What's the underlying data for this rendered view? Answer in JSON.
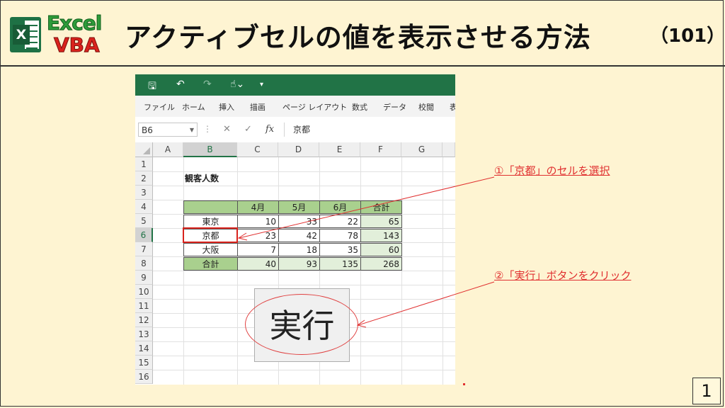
{
  "header": {
    "logo_top": "Excel",
    "logo_bottom": "VBA",
    "logo_tile_letter": "X",
    "title": "アクティブセルの値を表示させる方法",
    "number": "（101）"
  },
  "excel": {
    "qat_icons": [
      "save-icon",
      "undo-icon",
      "redo-icon",
      "touch-mode-icon",
      "customize-icon"
    ],
    "ribbon_tabs": [
      "ファイル",
      "ホーム",
      "挿入",
      "描画",
      "ページ レイアウト",
      "数式",
      "データ",
      "校閲",
      "表"
    ],
    "name_box": "B6",
    "formula_content": "京都",
    "fx": "fx",
    "columns": [
      "A",
      "B",
      "C",
      "D",
      "E",
      "F",
      "G"
    ],
    "rows": [
      "1",
      "2",
      "3",
      "4",
      "5",
      "6",
      "7",
      "8",
      "9",
      "10",
      "11",
      "12",
      "13",
      "14",
      "15",
      "16"
    ],
    "sheet_title": "観客人数",
    "table": {
      "headers": [
        "",
        "4月",
        "5月",
        "6月",
        "合計"
      ],
      "rows": [
        [
          "東京",
          "10",
          "33",
          "22",
          "65"
        ],
        [
          "京都",
          "23",
          "42",
          "78",
          "143"
        ],
        [
          "大阪",
          "7",
          "18",
          "35",
          "60"
        ],
        [
          "合計",
          "40",
          "93",
          "135",
          "268"
        ]
      ]
    },
    "run_button_label": "実行"
  },
  "annotations": {
    "step1": "①「京都」のセルを選択",
    "step2": "②「実行」ボタンをクリック"
  },
  "page_number": "1",
  "colors": {
    "background": "#fef4d2",
    "excel_green": "#217346",
    "accent_red": "#e03030"
  }
}
